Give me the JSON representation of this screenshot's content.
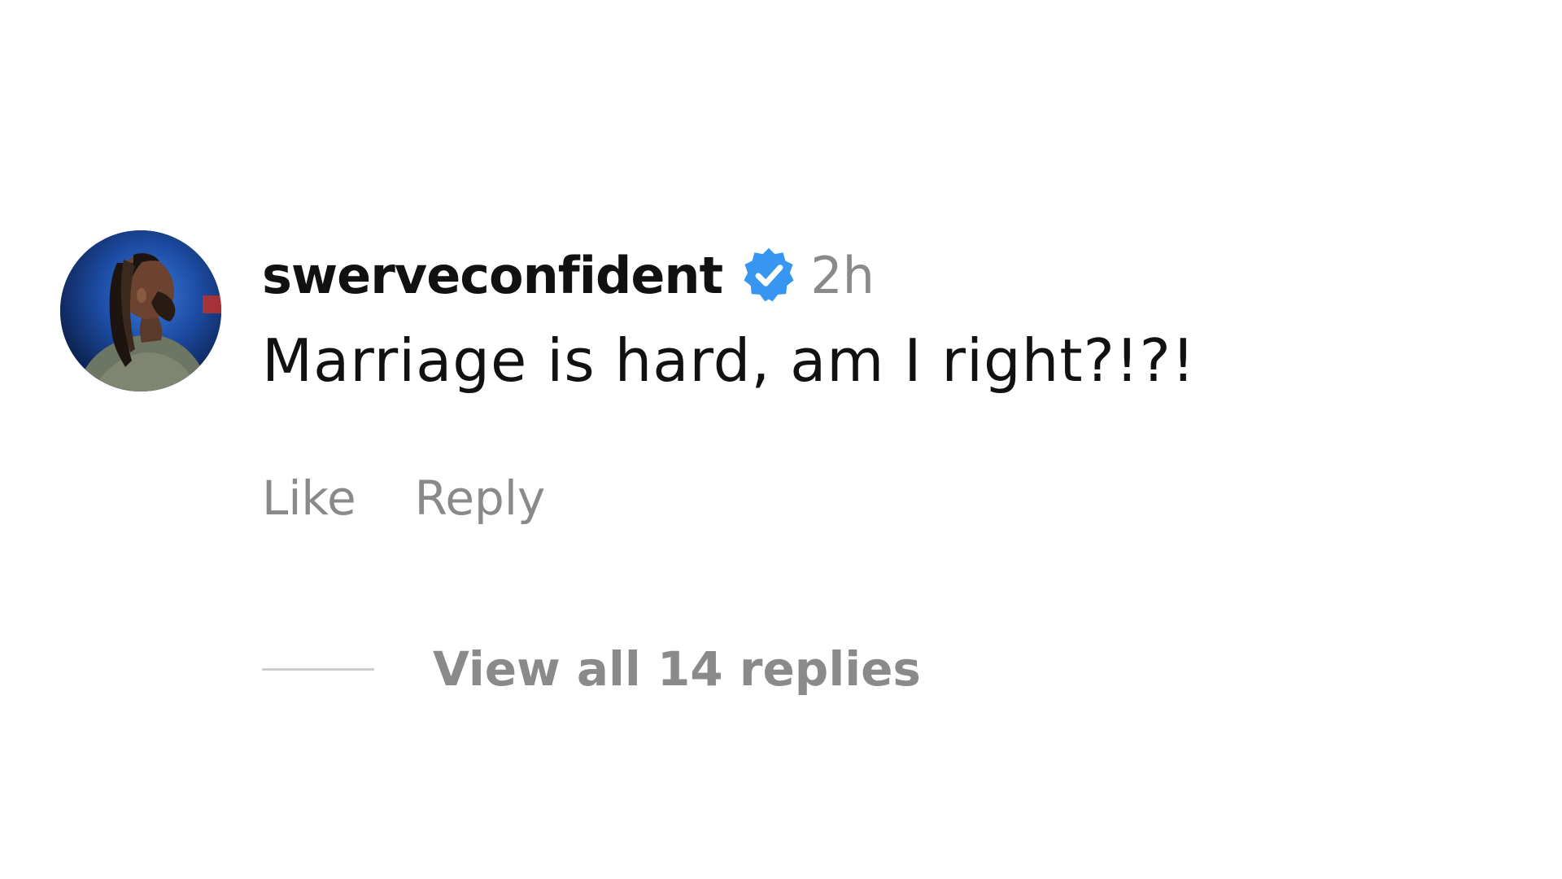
{
  "comment": {
    "username": "swerveconfident",
    "verified_icon": "verified-badge-icon",
    "verified_color": "#3797f0",
    "timestamp": "2h",
    "text": "Marriage is hard, am I right?!?!",
    "actions": {
      "like_label": "Like",
      "reply_label": "Reply"
    },
    "replies": {
      "view_label": "View all 14 replies"
    },
    "avatar_icon": "user-avatar"
  }
}
